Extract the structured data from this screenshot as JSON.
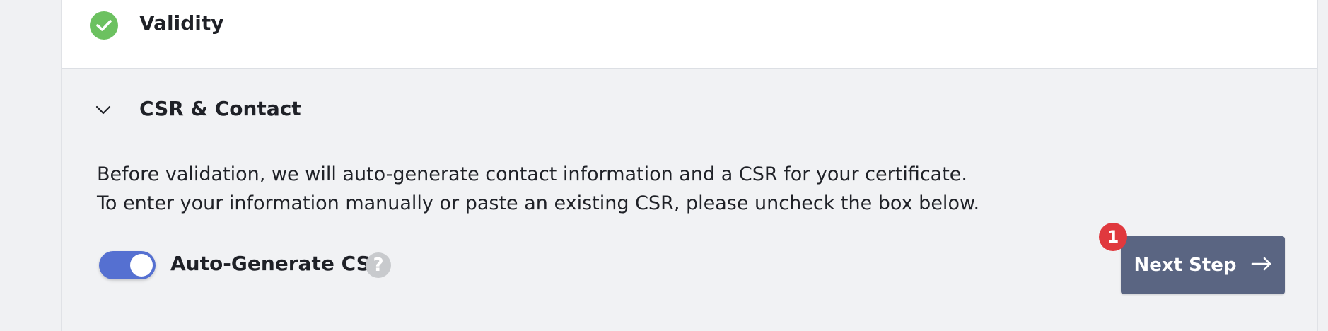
{
  "steps": {
    "validity": {
      "title": "Validity",
      "status": "complete",
      "icon": "check-circle-icon"
    },
    "csr_contact": {
      "title": "CSR & Contact",
      "expanded": true,
      "icon": "chevron-down-icon",
      "description_line1": "Before validation, we will auto-generate contact information and a CSR for your certificate.",
      "description_line2": "To enter your information manually or paste an existing CSR, please uncheck the box below."
    }
  },
  "auto_generate": {
    "label": "Auto-Generate CSR",
    "enabled": true,
    "help": "?"
  },
  "next_step": {
    "label": "Next Step",
    "icon": "arrow-right-icon",
    "badge": "1"
  },
  "colors": {
    "success": "#6cc160",
    "toggle_on": "#5570d1",
    "button": "#5a6582",
    "badge": "#e0393e",
    "help_icon": "#c8cacd"
  }
}
